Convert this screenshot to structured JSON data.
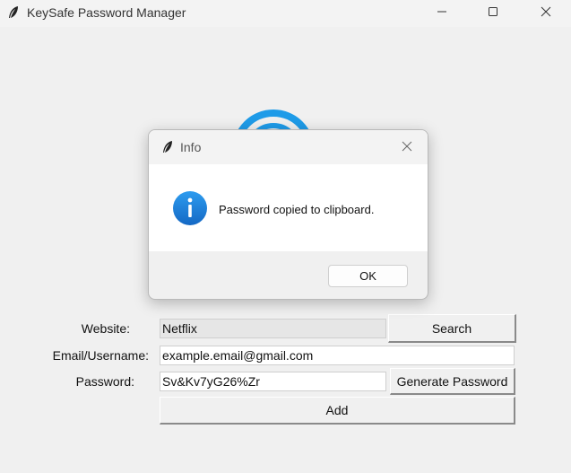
{
  "window": {
    "title": "KeySafe Password Manager"
  },
  "form": {
    "website_label": "Website:",
    "website_value": "Netflix",
    "email_label": "Email/Username:",
    "email_value": "example.email@gmail.com",
    "password_label": "Password:",
    "password_value": "Sv&Kv7yG26%Zr",
    "search_label": "Search",
    "generate_label": "Generate Password",
    "add_label": "Add"
  },
  "dialog": {
    "title": "Info",
    "message": "Password copied to clipboard.",
    "ok_label": "OK"
  },
  "icons": {
    "app": "feather-icon",
    "minimize": "minimize-icon",
    "maximize": "maximize-icon",
    "close": "close-icon",
    "info": "info-icon",
    "logo": "lock-logo"
  },
  "colors": {
    "info_blue": "#1a7fd4",
    "logo_blue": "#1e9be8"
  }
}
